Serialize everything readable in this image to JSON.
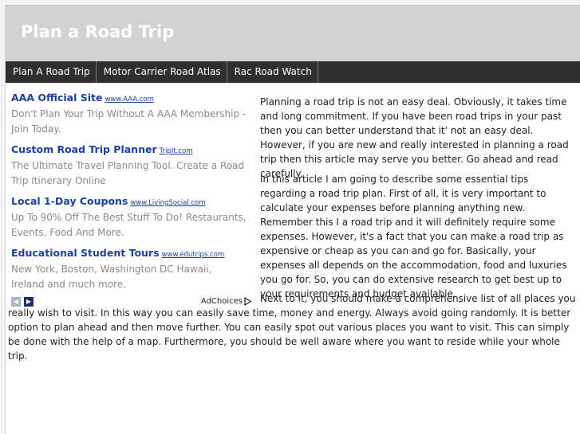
{
  "site": {
    "title": "Plan a Road Trip"
  },
  "nav": {
    "items": [
      {
        "label": "Plan A Road Trip"
      },
      {
        "label": "Motor Carrier Road Atlas"
      },
      {
        "label": "Rac Road Watch"
      }
    ]
  },
  "ads": {
    "items": [
      {
        "title": "AAA Official Site",
        "url": "www.AAA.com",
        "desc": "Don't Plan Your Trip Without A AAA Membership - Join Today."
      },
      {
        "title": "Custom Road Trip Planner",
        "url": "TripIt.com",
        "desc": "The Ultimate Travel Planning Tool. Create a Road Trip Itinerary Online"
      },
      {
        "title": "Local 1-Day Coupons",
        "url": "www.LivingSocial.com",
        "desc": "Up To 90% Off The Best Stuff To Do! Restaurants, Events, Food And More."
      },
      {
        "title": "Educational Student Tours",
        "url": "www.edutrips.com",
        "desc": "New York, Boston, Washington DC Hawaii, Ireland and much more."
      }
    ],
    "prev_arrow": "◀",
    "next_arrow": "▶",
    "adchoices_label": "AdChoices"
  },
  "article": {
    "p1": "Planning a road trip is not an easy deal. Obviously, it takes time and long commitment. If you have been road trips in your past then you can better understand that it' not an easy deal. However, if you are new and really interested in planning a road trip then this article may serve you better. Go ahead and read carefully.",
    "p2": "In this article I am going to describe some essential tips regarding a road trip plan. First of all, it is very important to calculate your expenses before planning anything new. Remember this I a road trip and it will definitely require some expenses. However, it's a fact that you can make a road trip as expensive or cheap as you can and go for. Basically, your expenses all depends on the accommodation, food and luxuries you go for. So, you can do extensive research to get best up to your requirements and budget available.",
    "p3_start": "Next to it, you should make a comprehensive list of all places you",
    "p3_rest": "really wish to visit. In this way you can easily save time, money and energy. Always avoid going randomly. It is better option to plan ahead and then move further. You can easily spot out various places you want to visit. This can simply be done with the help of a map. Furthermore, you should be well aware where you want to reside while your whole trip."
  }
}
